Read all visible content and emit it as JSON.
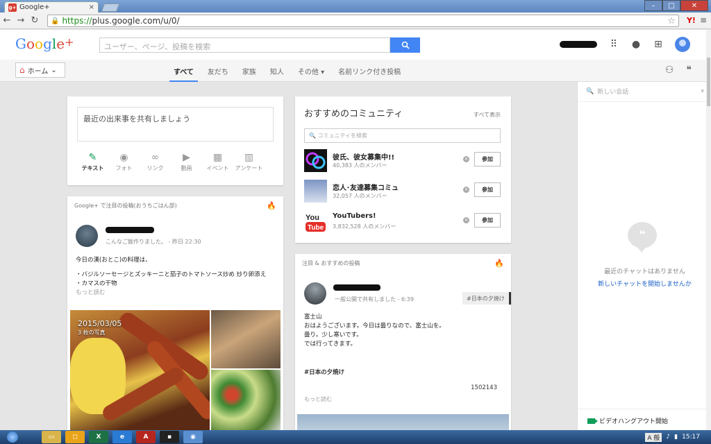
{
  "browser": {
    "tab_title": "Google+",
    "tab_favicon": "g+",
    "tab_close": "×",
    "url_scheme": "https://",
    "url_rest": "plus.google.com/u/0/",
    "toolbar_ext": "Y!"
  },
  "header": {
    "logo": {
      "g1": "G",
      "o1": "o",
      "o2": "o",
      "g2": "g",
      "l": "l",
      "e": "e",
      "plus": "+"
    },
    "search_placeholder": "ユーザー、ページ、投稿を検索"
  },
  "nav": {
    "home_label": "ホーム",
    "tabs": [
      {
        "label": "すべて",
        "active": true
      },
      {
        "label": "友だち"
      },
      {
        "label": "家族"
      },
      {
        "label": "知人"
      },
      {
        "label": "その他 ▾"
      },
      {
        "label": "名前リンク付き投稿"
      }
    ]
  },
  "share": {
    "prompt": "最近の出来事を共有しましょう",
    "actions": [
      {
        "label": "テキスト",
        "icon": "pencil-icon"
      },
      {
        "label": "フォト",
        "icon": "camera-icon"
      },
      {
        "label": "リンク",
        "icon": "link-icon"
      },
      {
        "label": "動画",
        "icon": "video-icon"
      },
      {
        "label": "イベント",
        "icon": "calendar-icon"
      },
      {
        "label": "アンケート",
        "icon": "poll-icon"
      }
    ]
  },
  "communities": {
    "title": "おすすめのコミュニティ",
    "see_all": "すべて表示",
    "search_placeholder": "コミュニティを検索",
    "join_label": "参加",
    "items": [
      {
        "name": "彼氏、彼女募集中!!",
        "members": "40,383 人のメンバー"
      },
      {
        "name": "恋人･友達募集コミュ",
        "members": "32,057 人のメンバー"
      },
      {
        "name": "YouTubers!",
        "members": "3,832,528 人のメンバー"
      }
    ]
  },
  "post1": {
    "header": "Google+ で注目の投稿(おうちごはん部)",
    "meta": "こんなご飯作りました。 - 昨日 22:30",
    "line1": "今日の漢(おとこ)の料理は、",
    "line2": "・バジルソーセージとズッキーニと茄子のトマトソース炒め 炒り卵添え",
    "line3": "・カマスの干物",
    "more": "もっと読む",
    "photo_date": "2015/03/05",
    "photo_count": "3 枚の写真"
  },
  "post2": {
    "header": "注目 & おすすめの投稿",
    "meta": "一般公開で共有しました - 6:39",
    "tag": "#日本の夕焼け",
    "lines": [
      "富士山",
      "おはようございます。今日は曇りなので、富士山を。",
      "曇り。少し寒いです。",
      "では行ってきます。"
    ],
    "hashtag": "#日本の夕焼け",
    "number": "1502143",
    "more": "もっと読む"
  },
  "chat": {
    "search_placeholder": "新しい会話",
    "none_text": "最近のチャットはありません",
    "start_link": "新しいチャットを開始しませんか",
    "hangout_label": "ビデオハングアウト開始"
  },
  "taskbar": {
    "ime": "A 般",
    "time": "15:17"
  }
}
